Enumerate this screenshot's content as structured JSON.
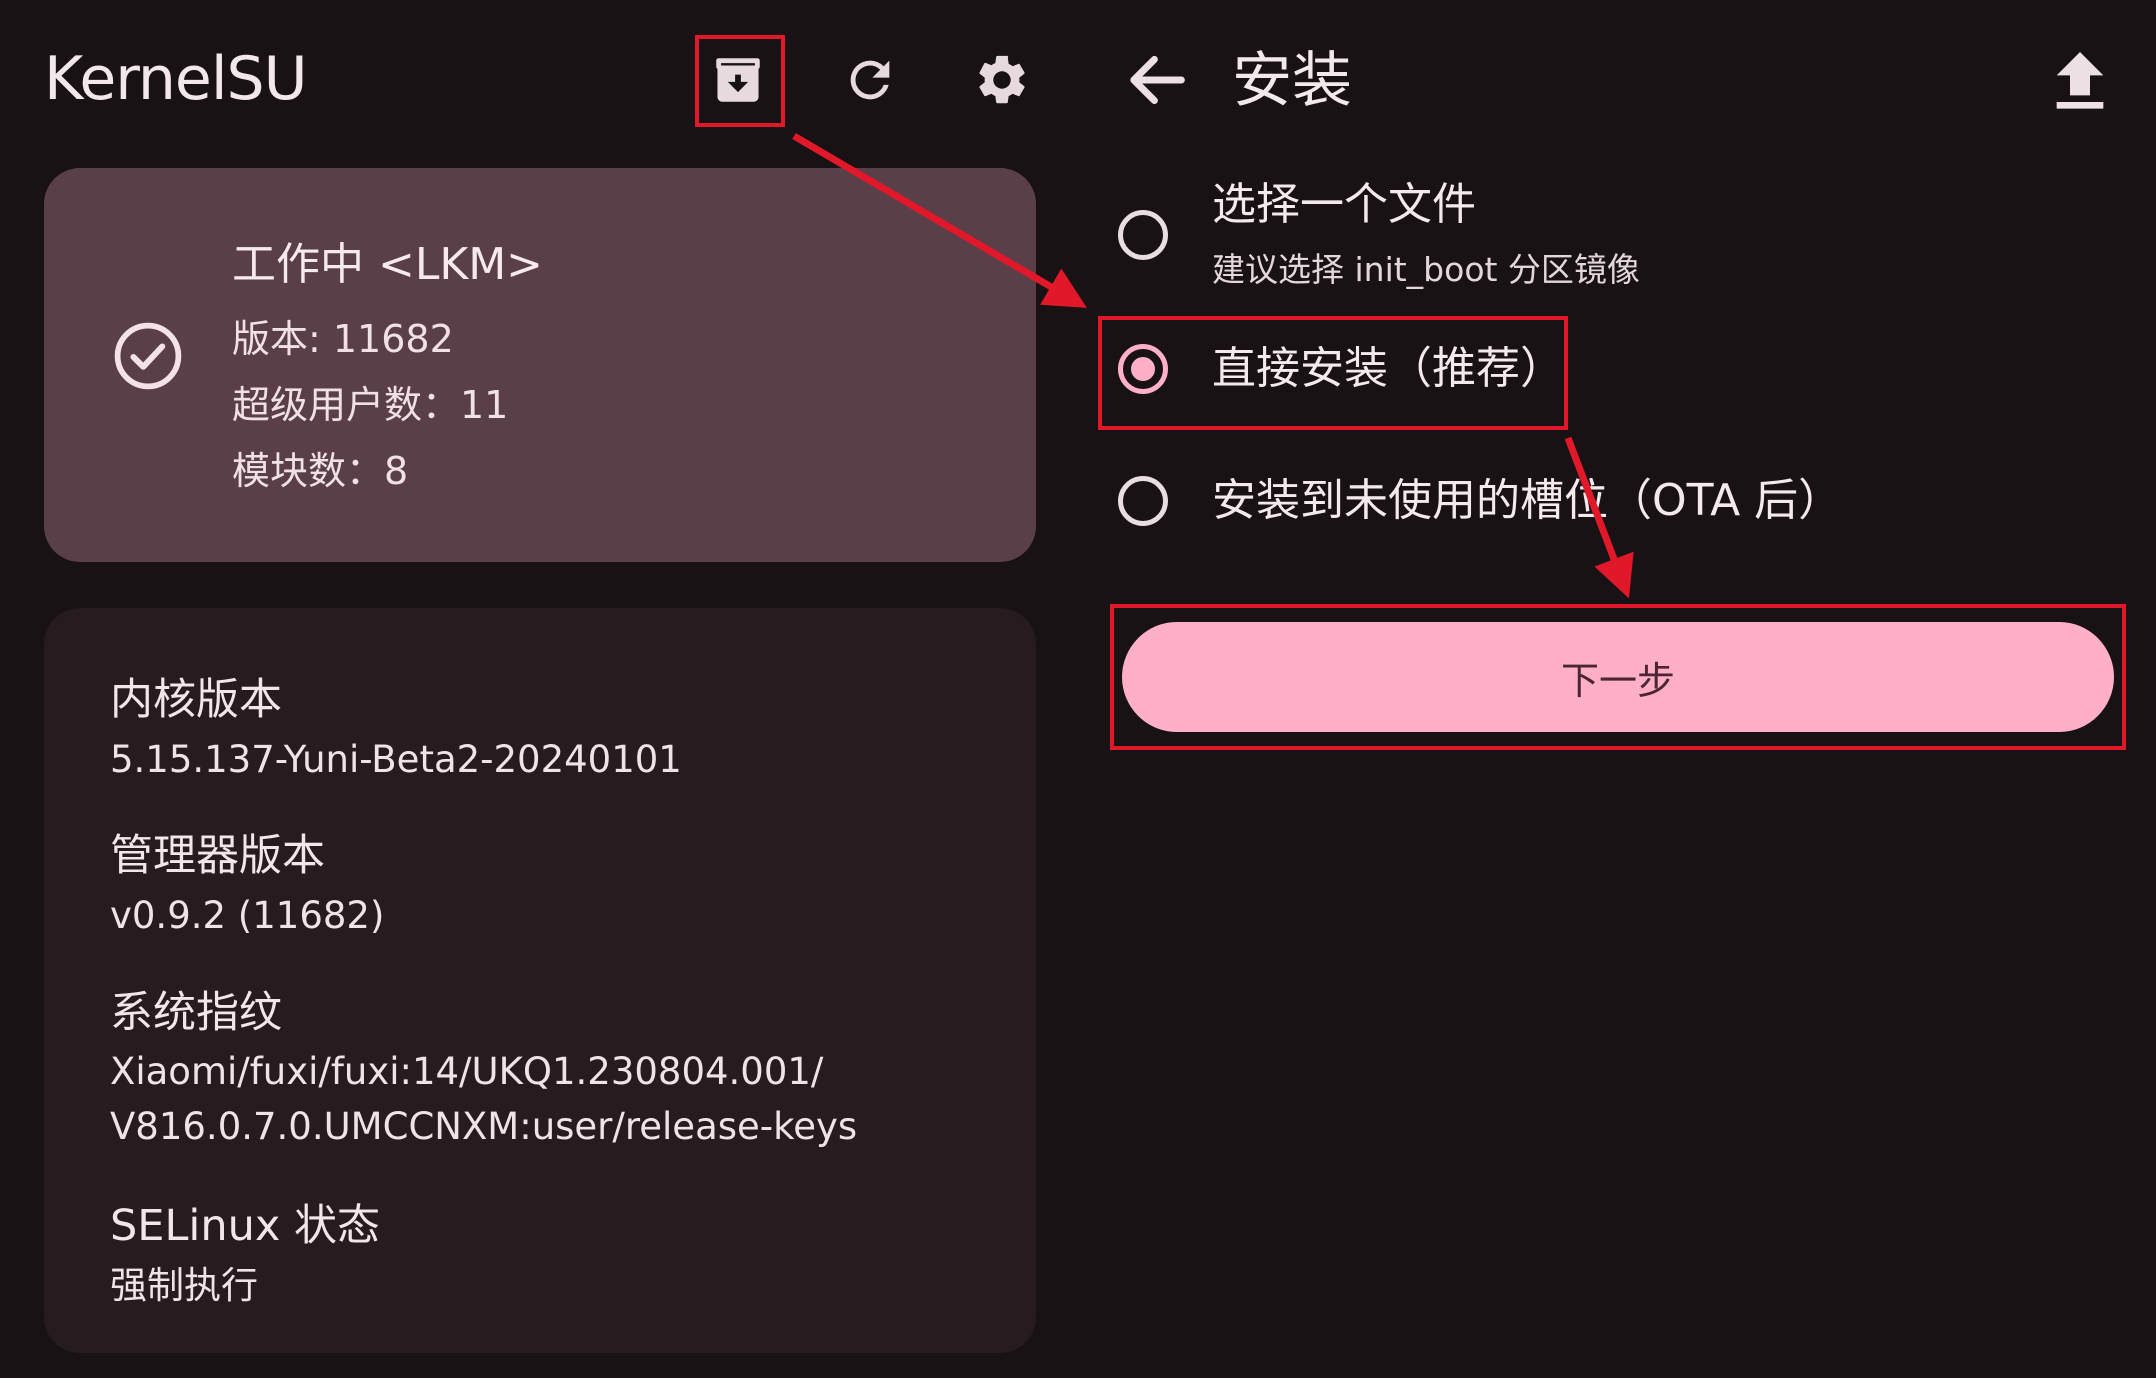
{
  "left": {
    "app_title": "KernelSU",
    "toolbar": {
      "install_icon": "archive-download-icon",
      "refresh_icon": "refresh-icon",
      "settings_icon": "gear-icon"
    },
    "status": {
      "title": "工作中 <LKM>",
      "version": "版本: 11682",
      "superusers": "超级用户数：11",
      "modules": "模块数：8",
      "icon": "check-circle-icon"
    },
    "info": [
      {
        "label": "内核版本",
        "value": "5.15.137-Yuni-Beta2-20240101"
      },
      {
        "label": "管理器版本",
        "value": "v0.9.2 (11682)"
      },
      {
        "label": "系统指纹",
        "value": "Xiaomi/fuxi/fuxi:14/UKQ1.230804.001/",
        "value2": "V816.0.7.0.UMCCNXM:user/release-keys"
      },
      {
        "label": "SELinux 状态",
        "value": "强制执行"
      }
    ]
  },
  "right": {
    "back_icon": "arrow-left-icon",
    "title": "安装",
    "upload_icon": "upload-icon",
    "options": [
      {
        "label": "选择一个文件",
        "sublabel": "建议选择 init_boot 分区镜像",
        "selected": false
      },
      {
        "label": "直接安装（推荐）",
        "selected": true
      },
      {
        "label": "安装到未使用的槽位（OTA 后）",
        "selected": false
      }
    ],
    "next_label": "下一步"
  },
  "colors": {
    "background": "#181214",
    "status_card": "#5b3f48",
    "info_card": "#261c20",
    "accent": "#ffb0c8",
    "annotation": "#e0182a"
  }
}
